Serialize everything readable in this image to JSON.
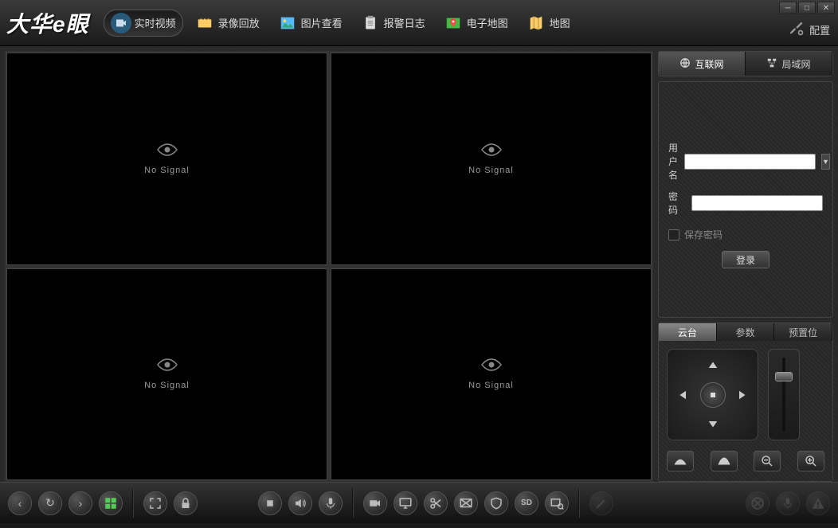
{
  "app": {
    "logo_text": "大华e眼"
  },
  "nav": {
    "items": [
      {
        "label": "实时视频",
        "icon": "video-icon",
        "color": "#6bd"
      },
      {
        "label": "录像回放",
        "icon": "film-icon",
        "color": "#fc6"
      },
      {
        "label": "图片查看",
        "icon": "picture-icon",
        "color": "#5bf"
      },
      {
        "label": "报警日志",
        "icon": "clipboard-icon",
        "color": "#ddd"
      },
      {
        "label": "电子地图",
        "icon": "emap-icon",
        "color": "#f55"
      },
      {
        "label": "地图",
        "icon": "map-icon",
        "color": "#fc6"
      }
    ],
    "config_label": "配置"
  },
  "video": {
    "cells": [
      {
        "text": "No Signal"
      },
      {
        "text": "No Signal"
      },
      {
        "text": "No Signal"
      },
      {
        "text": "No Signal"
      }
    ]
  },
  "network_tabs": {
    "internet": "互联网",
    "lan": "局域网"
  },
  "login": {
    "username_label": "用户名",
    "password_label": "密码",
    "save_pw_label": "保存密码",
    "login_btn": "登录"
  },
  "ptz": {
    "tabs": {
      "ptz": "云台",
      "params": "参数",
      "preset": "预置位"
    }
  }
}
